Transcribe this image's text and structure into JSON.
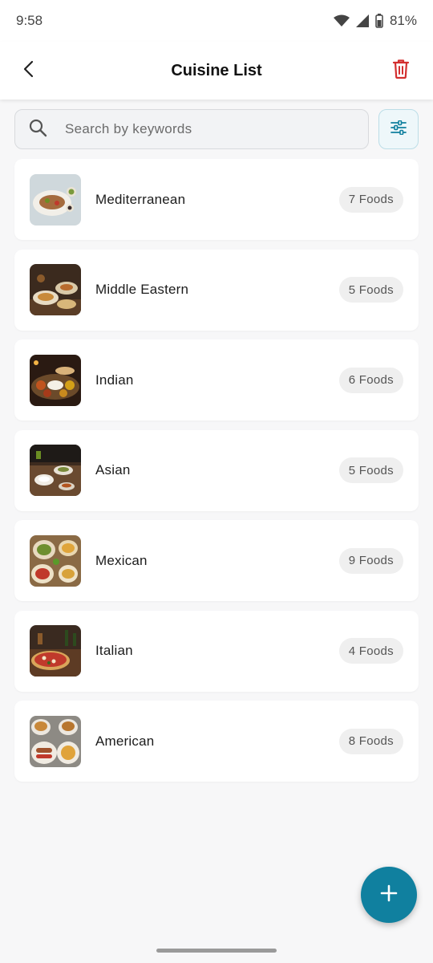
{
  "status_bar": {
    "time": "9:58",
    "battery": "81%",
    "icons": [
      "wifi-icon",
      "cell-signal-icon",
      "battery-icon"
    ]
  },
  "app_bar": {
    "title": "Cuisine List",
    "back_icon": "back-arrow-icon",
    "delete_icon": "trash-icon"
  },
  "search": {
    "placeholder": "Search by keywords",
    "value": "",
    "icon": "search-icon",
    "filter_icon": "sliders-icon"
  },
  "cuisines": [
    {
      "name": "Mediterranean",
      "count": "7 Foods"
    },
    {
      "name": "Middle Eastern",
      "count": "5 Foods"
    },
    {
      "name": "Indian",
      "count": "6 Foods"
    },
    {
      "name": "Asian",
      "count": "5 Foods"
    },
    {
      "name": "Mexican",
      "count": "9 Foods"
    },
    {
      "name": "Italian",
      "count": "4 Foods"
    },
    {
      "name": "American",
      "count": "8 Foods"
    }
  ],
  "fab": {
    "icon": "plus-icon"
  },
  "colors": {
    "accent": "#10809f",
    "delete": "#d32f2f",
    "badge_bg": "#efefef",
    "background": "#f7f7f8"
  }
}
